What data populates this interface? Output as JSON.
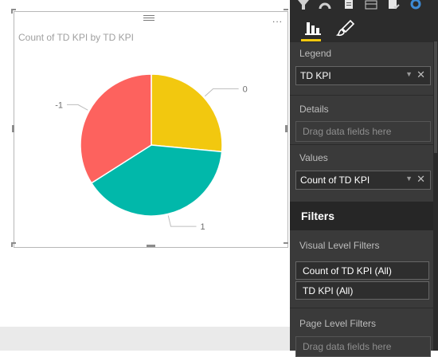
{
  "visual": {
    "title": "Count of TD KPI by TD KPI",
    "more_label": "..."
  },
  "chart_data": {
    "type": "pie",
    "title": "Count of TD KPI by TD KPI",
    "categories": [
      "0",
      "1",
      "-1"
    ],
    "values": [
      26.5,
      39.5,
      34
    ],
    "colors": [
      "#F2C80F",
      "#01B8AA",
      "#FD625E"
    ],
    "start_angle_deg": -90,
    "legend": "none",
    "data_labels": "category-name-outside"
  },
  "pane": {
    "legend": {
      "label": "Legend",
      "field": "TD KPI"
    },
    "details": {
      "label": "Details",
      "placeholder": "Drag data fields here"
    },
    "values": {
      "label": "Values",
      "field": "Count of TD KPI"
    },
    "filters": {
      "header": "Filters",
      "visual_level_label": "Visual Level Filters",
      "visual_filters": [
        "Count of TD KPI (All)",
        "TD KPI (All)"
      ],
      "page_level_label": "Page Level Filters",
      "page_placeholder": "Drag data fields here"
    },
    "accent_color": "#F2C80F"
  },
  "icons": {
    "top": [
      "filter-icon",
      "gauge-icon",
      "card-icon",
      "table-icon",
      "checklist-icon",
      "donut-icon"
    ],
    "tabs": [
      "fields-icon",
      "format-paintbrush-icon"
    ],
    "well_chevron": "chevron-down-icon",
    "well_remove": "close-icon"
  }
}
